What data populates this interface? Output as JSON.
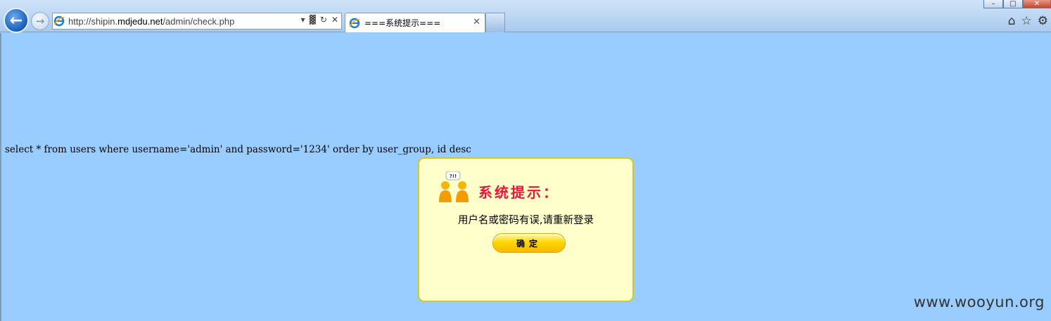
{
  "browser": {
    "address": {
      "prefix": "http://shipin.",
      "domain": "mdjedu.net",
      "path": "/admin/check.php"
    },
    "tab": {
      "title": "===系统提示==="
    },
    "icons": {
      "back": "back-arrow-icon",
      "forward": "forward-arrow-icon",
      "ie": "internet-explorer-icon",
      "home": "home-icon",
      "favorites": "star-icon"
    }
  },
  "page": {
    "sql_query": "select * from users where username='admin' and password='1234' order by user_group, id desc",
    "dialog": {
      "heading": "系统提示：",
      "message": "用户名或密码有误,请重新登录",
      "ok_label": "确定",
      "bubble_text": "?!!"
    },
    "watermark": "www.wooyun.org"
  },
  "colors": {
    "page_background": "#99ccff",
    "dialog_background": "#ffffcc",
    "dialog_border": "#c9cc2a",
    "heading_red": "#e8183a",
    "button_yellow": "#ffd700"
  }
}
